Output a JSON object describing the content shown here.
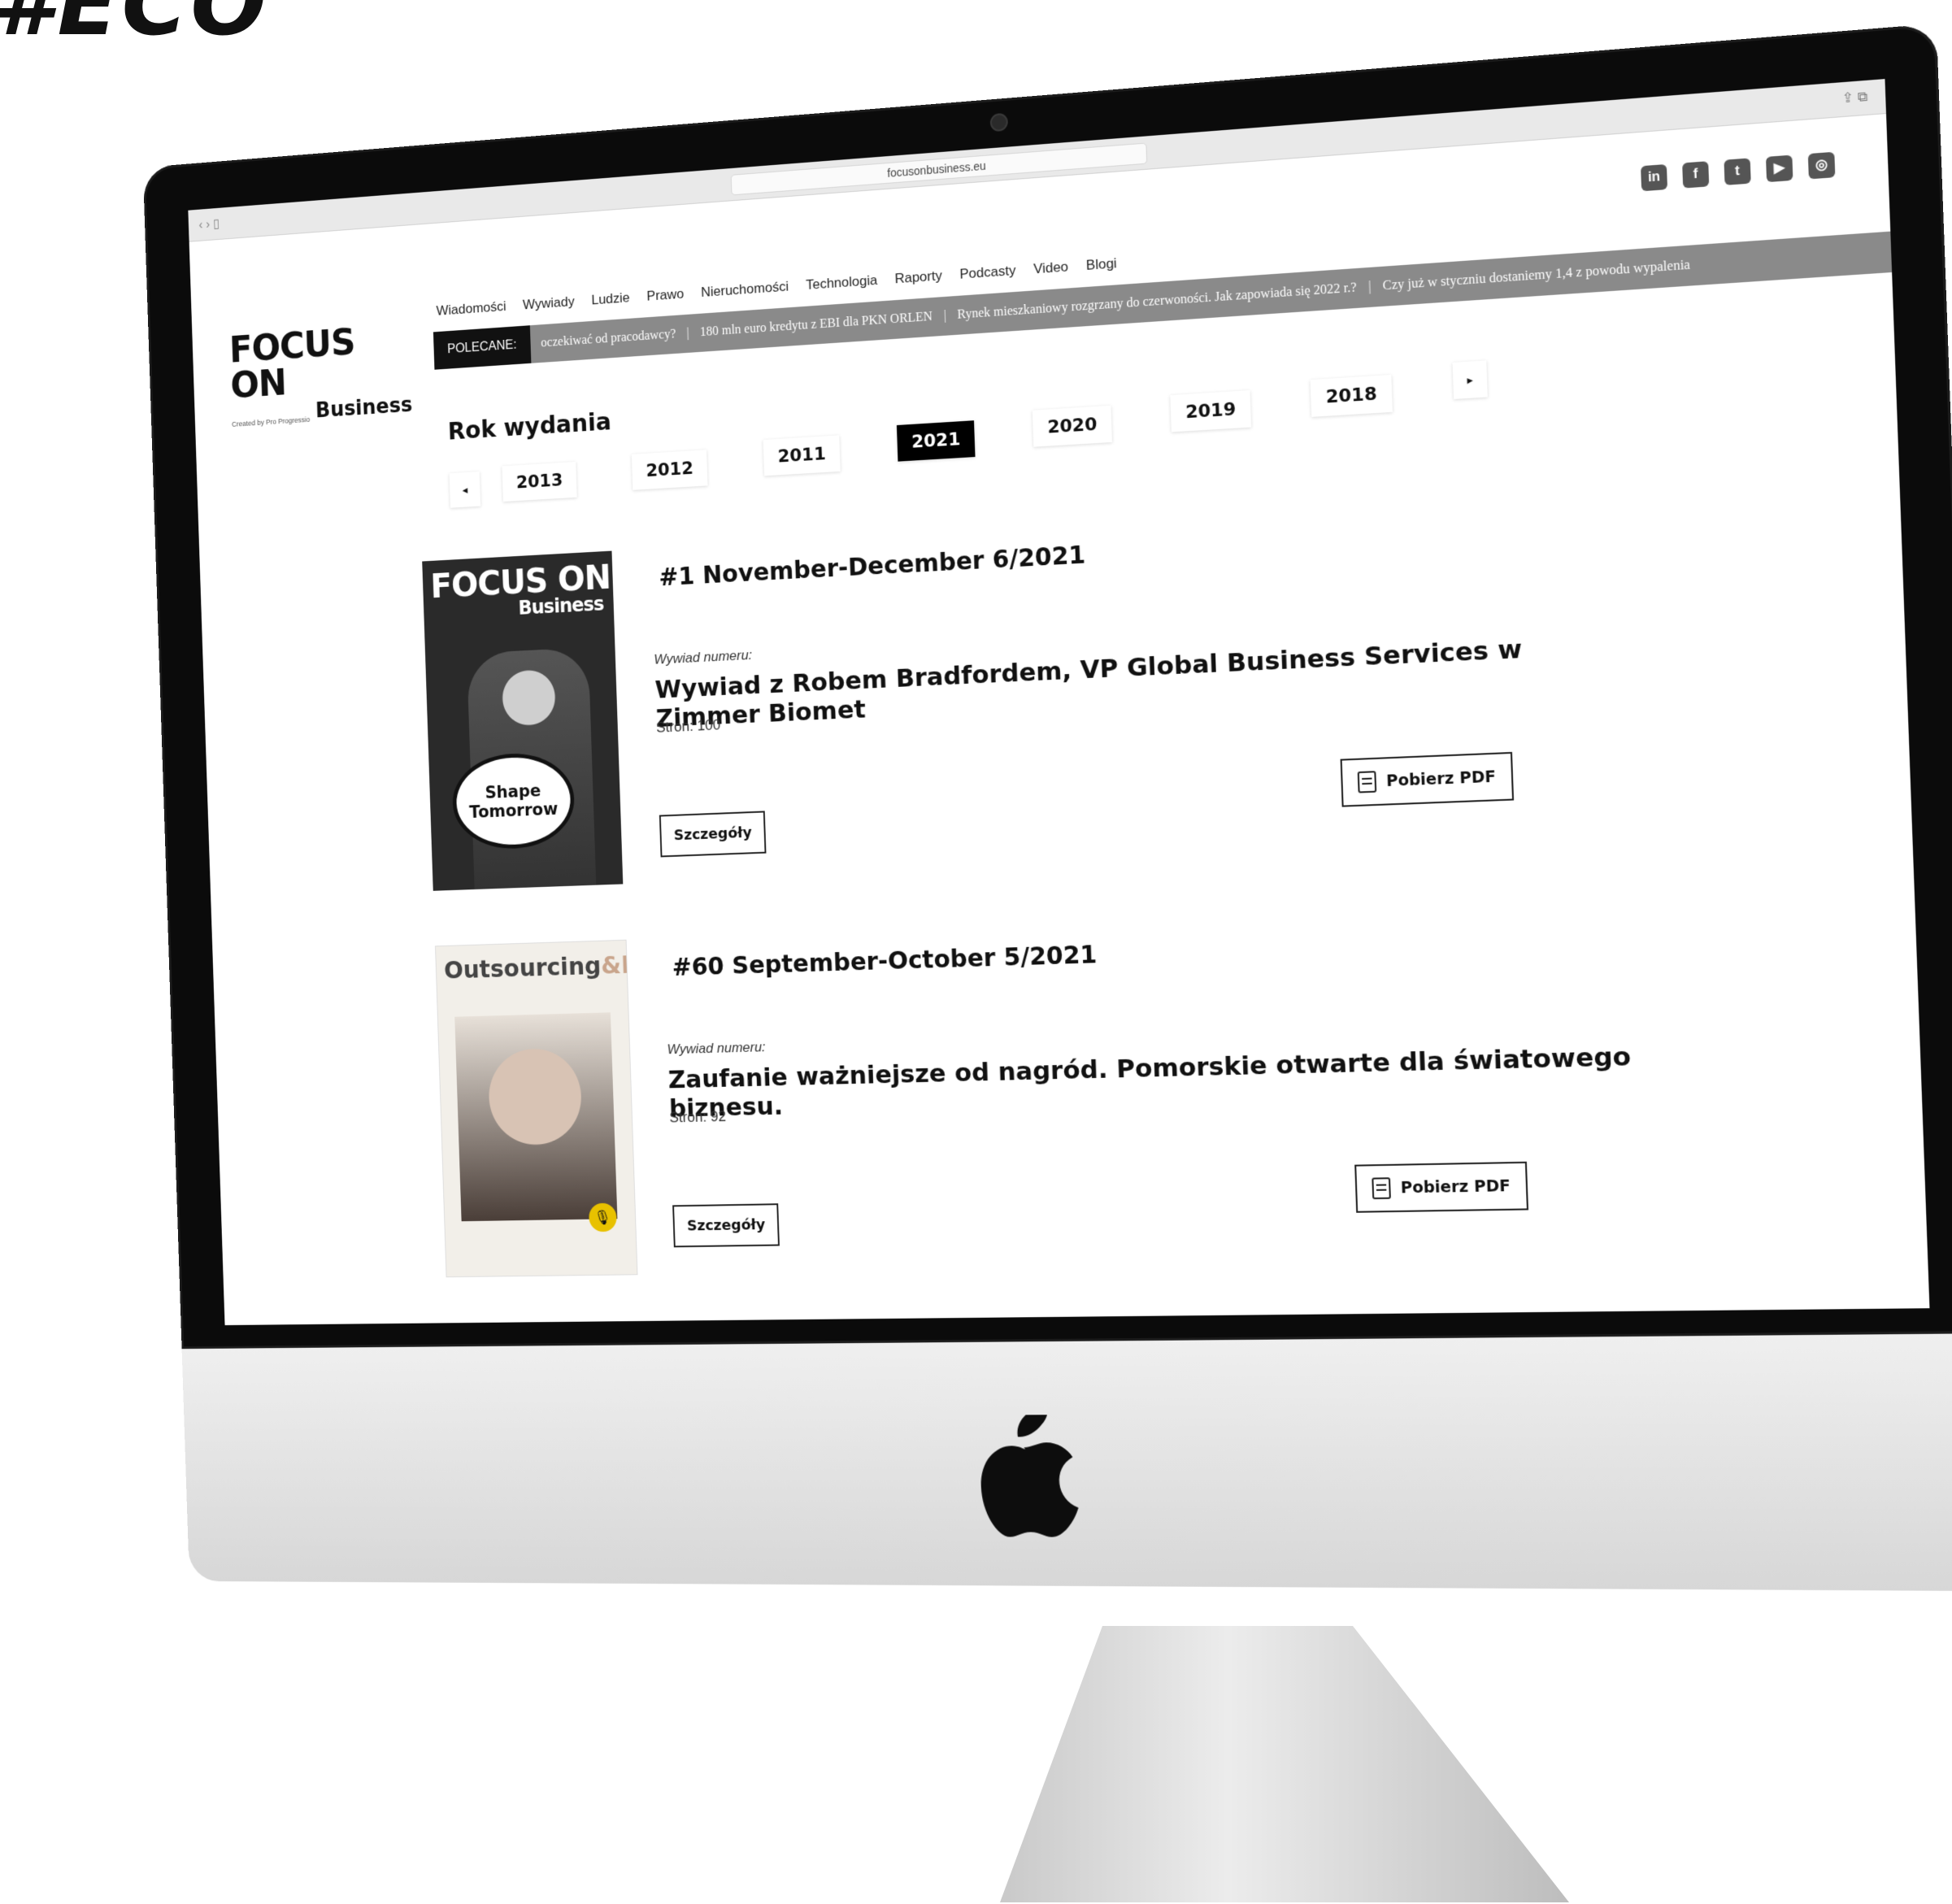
{
  "corner_text": "#ECO",
  "browser": {
    "url": "focusonbusiness.eu",
    "nav_arrows": "‹ › ▯",
    "right_icons": "⇪ ⧉"
  },
  "site": {
    "logo_main": "FOCUS ON",
    "logo_created": "Created by Pro Progressio",
    "logo_business": "Business",
    "social": [
      "in",
      "f",
      "t",
      "▶",
      "◎"
    ],
    "social_icons": [
      "linkedin-icon",
      "facebook-icon",
      "twitter-icon",
      "youtube-icon",
      "instagram-icon"
    ],
    "nav": [
      "Wiadomości",
      "Wywiady",
      "Ludzie",
      "Prawo",
      "Nieruchomości",
      "Technologia",
      "Raporty",
      "Podcasty",
      "Video",
      "Blogi"
    ],
    "ticker_label": "POLECANE:",
    "ticker_items": [
      "oczekiwać od pracodawcy?",
      "180 mln euro kredytu z EBI dla PKN ORLEN",
      "Rynek mieszkaniowy rozgrzany do czerwoności. Jak zapowiada się 2022 r.?",
      "Czy już w styczniu dostaniemy 1,4 z powodu wypalenia"
    ],
    "ticker_sep": "|"
  },
  "years": {
    "title": "Rok wydania",
    "prev": "◂",
    "next": "▸",
    "items": [
      "2013",
      "2012",
      "2011",
      "2021",
      "2020",
      "2019",
      "2018"
    ],
    "active": "2021"
  },
  "issues": [
    {
      "cover_brand": "FOCUS ON",
      "cover_brand_sub": "Business",
      "cover_bubble_1": "Shape",
      "cover_bubble_2": "Tomorrow",
      "title": "#1 November-December 6/2021",
      "label": "Wywiad numeru:",
      "headline": "Wywiad z Robem Bradfordem, VP Global Business Services w Zimmer Biomet",
      "pages": "Stron: 100",
      "details": "Szczegóły",
      "pdf": "Pobierz PDF"
    },
    {
      "cover_brand": "Outsourcing",
      "cover_brand_more": "&More",
      "title": "#60 September-October 5/2021",
      "label": "Wywiad numeru:",
      "headline": "Zaufanie ważniejsze od nagród. Pomorskie otwarte dla światowego biznesu.",
      "pages": "Stron: 92",
      "details": "Szczegóły",
      "pdf": "Pobierz PDF"
    }
  ],
  "colors": {
    "ticker_bg": "#8a8a8a",
    "active_year_bg": "#000000",
    "accent_badge": "#e8c100"
  }
}
